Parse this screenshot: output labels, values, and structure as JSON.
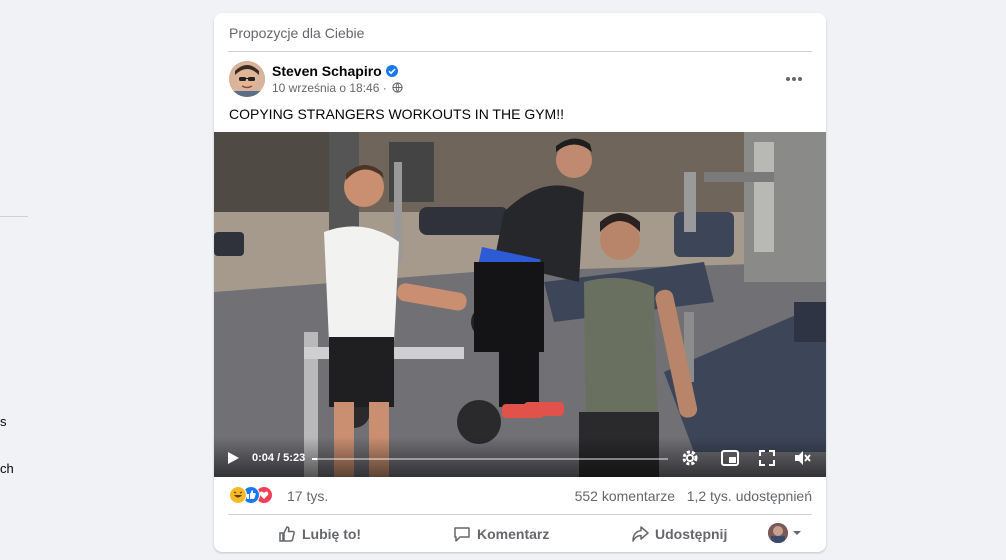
{
  "sidebar": {
    "fragments": [
      "s",
      "ch"
    ]
  },
  "post": {
    "section_title": "Propozycje dla Ciebie",
    "author": "Steven Schapiro",
    "timestamp": "10 września o 18:46 ·",
    "caption": "COPYING STRANGERS WORKOUTS IN THE GYM!!",
    "video": {
      "current_time": "0:04",
      "separator": "/",
      "duration": "5:23",
      "time_label": "0:04 / 5:23",
      "progress_fraction": 0.013
    },
    "reactions": {
      "count": "17 tys.",
      "types": [
        "haha",
        "like",
        "love"
      ],
      "colors": {
        "haha": "#f7b928",
        "like": "#1877f2",
        "love": "#f33e58"
      }
    },
    "comments": "552 komentarze",
    "shares": "1,2 tys. udostępnień",
    "actions": {
      "like": "Lubię to!",
      "comment": "Komentarz",
      "share": "Udostępnij"
    }
  },
  "icons": {
    "verified": "verified-badge-icon",
    "audience": "globe-icon",
    "more": "more-options-icon",
    "play": "play-icon",
    "settings": "gear-icon",
    "pip": "picture-in-picture-icon",
    "fullscreen": "fullscreen-icon",
    "volume": "volume-muted-icon"
  },
  "colors": {
    "accent": "#1877f2",
    "secondary_text": "#65676b",
    "background": "#f0f2f5"
  }
}
